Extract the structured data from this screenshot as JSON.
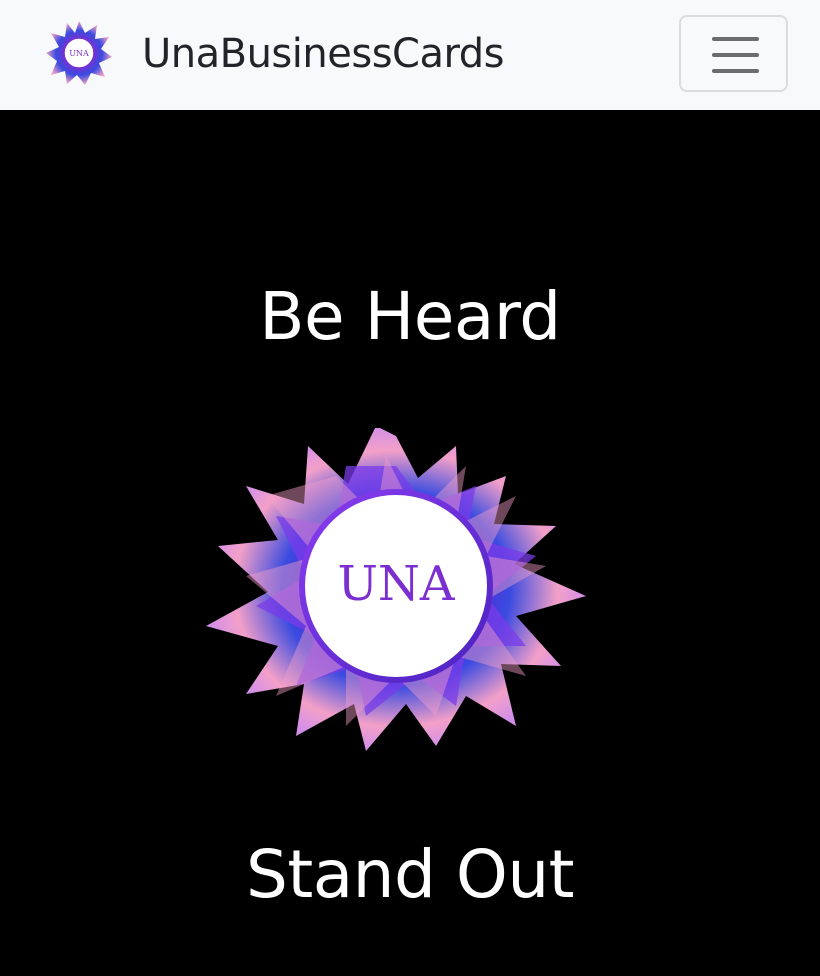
{
  "navbar": {
    "brand_name": "UnaBusinessCards",
    "logo_text": "UNA",
    "toggle_icon": "hamburger-menu-icon"
  },
  "hero": {
    "headline_top": "Be Heard",
    "logo_text": "UNA",
    "headline_bottom": "Stand Out"
  },
  "colors": {
    "navbar_bg": "#f8f9fa",
    "hero_bg": "#000000",
    "logo_purple": "#7b2fd0",
    "logo_pink": "#f3a0c8",
    "logo_blue": "#3a4be0"
  }
}
